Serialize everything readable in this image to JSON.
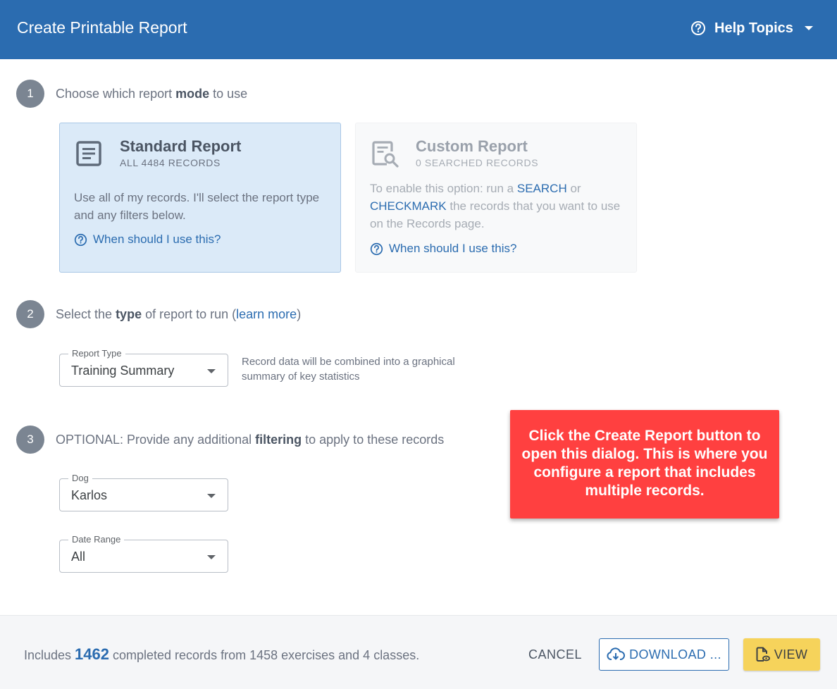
{
  "header": {
    "title": "Create Printable Report",
    "help_label": "Help Topics"
  },
  "steps": [
    {
      "number": "1",
      "prefix": "Choose which report ",
      "bold": "mode",
      "suffix": " to use"
    },
    {
      "number": "2",
      "prefix": "Select the ",
      "bold": "type",
      "middle": " of report to run (",
      "link": "learn more",
      "suffix": ")"
    },
    {
      "number": "3",
      "prefix": "OPTIONAL: Provide any additional ",
      "bold": "filtering",
      "suffix": " to apply to these records"
    }
  ],
  "mode_cards": {
    "standard": {
      "title": "Standard Report",
      "subtitle": "ALL 4484 RECORDS",
      "description": "Use all of my records. I'll select the report type and any filters below.",
      "help_link": "When should I use this?",
      "icon": "list-document-icon"
    },
    "custom": {
      "title": "Custom Report",
      "subtitle": "0 SEARCHED RECORDS",
      "desc_part1": "To enable this option: run a ",
      "desc_link1": "SEARCH",
      "desc_part2": " or ",
      "desc_link2": "CHECKMARK",
      "desc_part3": " the records that you want to use on the Records page.",
      "help_link": "When should I use this?",
      "icon": "document-search-icon"
    }
  },
  "report_type": {
    "label": "Report Type",
    "value": "Training Summary",
    "description": "Record data will be combined into a graphical summary of key statistics"
  },
  "filters": {
    "dog": {
      "label": "Dog",
      "value": "Karlos"
    },
    "date_range": {
      "label": "Date Range",
      "value": "All"
    }
  },
  "callout": {
    "text": "Click the Create Report button to open this dialog. This is where you configure a report that includes multiple records."
  },
  "footer": {
    "summary_prefix": "Includes ",
    "summary_count": "1462",
    "summary_suffix": " completed records from 1458 exercises and 4 classes.",
    "cancel_label": "CANCEL",
    "download_label": "DOWNLOAD ...",
    "view_label": "VIEW"
  },
  "colors": {
    "header_bg": "#2b6cb0",
    "accent": "#2b6cb0",
    "selected_card_bg": "#dbeaf8",
    "callout_bg": "#ff4040",
    "view_button_bg": "#f6d35b",
    "step_circle": "#7b8592"
  }
}
